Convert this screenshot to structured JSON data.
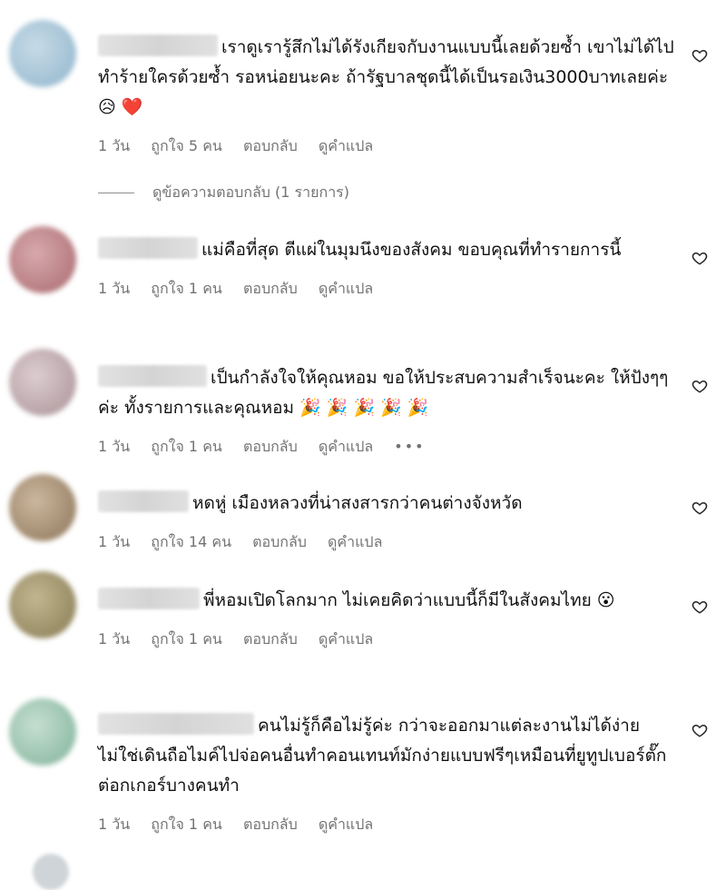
{
  "comments": [
    {
      "text": "เราดูเรารู้สึกไม่ได้รังเกียจกับงานแบบนี้เลยด้วยซ้ำ เขาไม่ได้ไปทำร้ายใครด้วยซ้ำ รอหน่อยนะคะ ถ้ารัฐบาลชุดนี้ได้เป็นรอเงิน3000บาทเลยค่ะ 😥 ❤️",
      "time": "1 วัน",
      "likes": "ถูกใจ 5 คน",
      "reply": "ตอบกลับ",
      "translate": "ดูคำแปล",
      "avatar_color": "#a9c6da"
    },
    {
      "text": "แม่คือที่สุด ตีแผ่ในมุมนึงของสังคม ขอบคุณที่ทำรายการนี้",
      "time": "1 วัน",
      "likes": "ถูกใจ 1 คน",
      "reply": "ตอบกลับ",
      "translate": "ดูคำแปล",
      "avatar_color": "#c98a8f"
    },
    {
      "text": "เป็นกำลังใจให้คุณหอม ขอให้ประสบความสำเร็จนะคะ ให้ปังๆๆค่ะ ทั้งรายการและคุณหอม 🎉 🎉 🎉 🎉 🎉",
      "time": "1 วัน",
      "likes": "ถูกใจ 1 คน",
      "reply": "ตอบกลับ",
      "translate": "ดูคำแปล",
      "more": "•••",
      "avatar_color": "#cbb8bc"
    },
    {
      "text": "หดหู่ เมืองหลวงที่น่าสงสารกว่าคนต่างจังหวัด",
      "time": "1 วัน",
      "likes": "ถูกใจ 14 คน",
      "reply": "ตอบกลับ",
      "translate": "ดูคำแปล",
      "avatar_color": "#b39d84"
    },
    {
      "text": "พี่หอมเปิดโลกมาก ไม่เคยคิดว่าแบบนี้ก็มีในสังคมไทย 😮",
      "time": "1 วัน",
      "likes": "ถูกใจ 1 คน",
      "reply": "ตอบกลับ",
      "translate": "ดูคำแปล",
      "avatar_color": "#a69a74"
    },
    {
      "text": "คนไม่รู้ก็คือไม่รู้ค่ะ กว่าจะออกมาแต่ละงานไม่ได้ง่าย ไม่ใช่เดินถือไมค์ไปจ่อคนอื่นทำคอนเทนท์มักง่ายแบบฟรีๆเหมือนที่ยูทูปเบอร์ตั๊กต่อกเกอร์บางคนทำ",
      "time": "1 วัน",
      "likes": "ถูกใจ 1 คน",
      "reply": "ตอบกลับ",
      "translate": "ดูคำแปล",
      "avatar_color": "#a9c9b8"
    }
  ],
  "view_replies": "ดูข้อความตอบกลับ (1 รายการ)"
}
